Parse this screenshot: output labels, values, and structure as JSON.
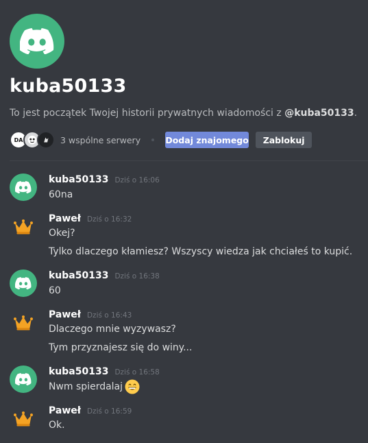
{
  "header": {
    "username": "kuba50133",
    "intro_prefix": "To jest początek Twojej historii prywatnych wiadomości z ",
    "intro_handle": "@kuba50133",
    "intro_suffix": "."
  },
  "mutual": {
    "server_icons": [
      "DA",
      "",
      ""
    ],
    "label": "3 wspólne serwery",
    "add_friend_label": "Dodaj znajomego",
    "block_label": "Zablokuj"
  },
  "colors": {
    "discord_green": "#43b581",
    "blurple": "#7289da",
    "background": "#36393f"
  },
  "messages": [
    {
      "author": "kuba50133",
      "avatar": "discord-logo-icon",
      "time": "Dziś o 16:06",
      "lines": [
        "60na"
      ]
    },
    {
      "author": "Paweł",
      "avatar": "crown-icon",
      "time": "Dziś o 16:32",
      "lines": [
        "Okej?",
        "Tylko dlaczego kłamiesz? Wszyscy wiedza jak chciałeś to kupić."
      ]
    },
    {
      "author": "kuba50133",
      "avatar": "discord-logo-icon",
      "time": "Dziś o 16:38",
      "lines": [
        "60"
      ]
    },
    {
      "author": "Paweł",
      "avatar": "crown-icon",
      "time": "Dziś o 16:43",
      "lines": [
        "Dlaczego mnie wyzywasz?",
        "Tym przyznajesz się do winy..."
      ]
    },
    {
      "author": "kuba50133",
      "avatar": "discord-logo-icon",
      "time": "Dziś o 16:58",
      "lines": [
        "Nwm spierdalaj"
      ],
      "emoji": "grinning-face-emoji"
    },
    {
      "author": "Paweł",
      "avatar": "crown-icon",
      "time": "Dziś o 16:59",
      "lines": [
        "Ok."
      ]
    }
  ]
}
